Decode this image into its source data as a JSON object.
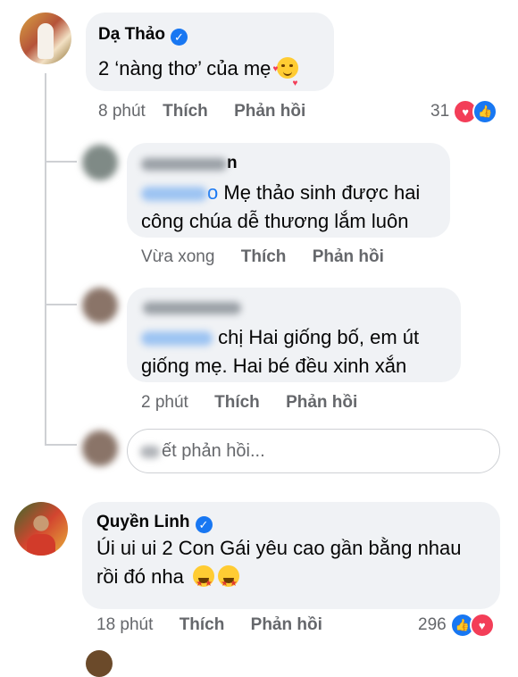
{
  "comments": [
    {
      "author": "Dạ Thảo",
      "text": "2 ‘nàng thơ’ của mẹ",
      "time": "8 phút",
      "like": "Thích",
      "reply": "Phản hồi",
      "reactions": "31"
    },
    {
      "author": "Quyền Linh",
      "text_line1": "Úi ui ui 2 Con Gái yêu cao gần bằng nhau",
      "text_line2": "rồi đó nha",
      "time": "18 phút",
      "like": "Thích",
      "reply": "Phản hồi",
      "reactions": "296"
    }
  ],
  "replies": [
    {
      "author_tail": "n",
      "mention_tail": "o",
      "text_line1": "Mẹ thảo sinh được hai",
      "text_line2": "công chúa dễ thương lắm luôn",
      "time": "Vừa xong",
      "like": "Thích",
      "reply": "Phản hồi"
    },
    {
      "text_line1": "chị Hai giống bố, em út",
      "text_line2": "giống mẹ. Hai bé đều xinh xắn",
      "time": "2 phút",
      "like": "Thích",
      "reply": "Phản hồi"
    }
  ],
  "reply_input": {
    "placeholder_visible": "ết phản hồi..."
  },
  "colors": {
    "accent": "#1877f2",
    "love": "#f33e58",
    "bubble": "#f0f2f5"
  }
}
